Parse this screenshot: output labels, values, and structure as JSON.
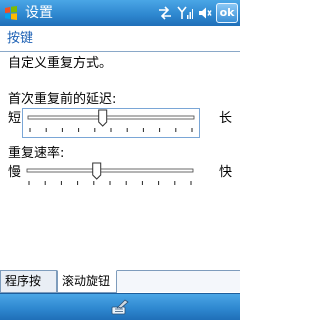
{
  "titlebar": {
    "title": "设置",
    "ok_label": "ok",
    "icons": [
      "start-flag-icon",
      "sync-icon",
      "signal-icon",
      "speaker-icon"
    ]
  },
  "page": {
    "heading": "按键",
    "description": "自定义重复方式。"
  },
  "delay": {
    "label": "首次重复前的延迟:",
    "min_label": "短",
    "max_label": "长",
    "value": 0.45
  },
  "rate": {
    "label": "重复速率:",
    "min_label": "慢",
    "max_label": "快",
    "value": 0.42
  },
  "tabs": [
    {
      "label": "程序按键",
      "active": false
    },
    {
      "label": "滚动旋钮",
      "active": true
    }
  ],
  "menubar": {
    "icon": "keyboard-input-icon"
  },
  "colors": {
    "titlebar": "#2f88d0",
    "heading": "#1f62b5",
    "focus_border": "#7aa6d6"
  }
}
